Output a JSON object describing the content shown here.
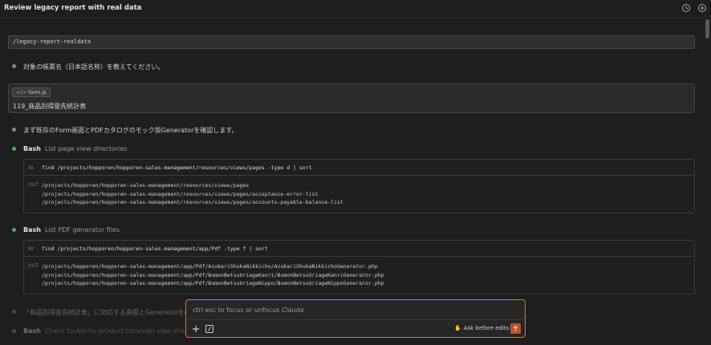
{
  "header": {
    "title": "Review legacy report with real data",
    "history_icon": "history-icon",
    "new_session_icon": "new-session-icon"
  },
  "command": "/legacy-report-realdata",
  "messages": [
    {
      "text": "対象の帳票名（日本語名称）を教えてください。"
    },
    {
      "text": "まず既存のForm画面とPDFカタログのモック版Generatorを確認します。"
    }
  ],
  "file_card": {
    "chip_icon": "code-icon",
    "chip_label": "form.js",
    "content": "119_商品別得意先統計表"
  },
  "tools": [
    {
      "name": "Bash",
      "description": "List page view directories",
      "in_label": "IN",
      "in": "find /projects/hopporen/hopporen-sales-management/resources/views/pages -type d | sort",
      "out_label": "OUT",
      "out": [
        "/projects/hopporen/hopporen-sales-management/resources/views/pages",
        "/projects/hopporen/hopporen-sales-management/resources/views/pages/acceptance-error-list",
        "/projects/hopporen/hopporen-sales-management/resources/views/pages/accounts-payable-balance-list"
      ]
    },
    {
      "name": "Bash",
      "description": "List PDF generator files",
      "in_label": "IN",
      "in": "find /projects/hopporen/hopporen-sales-management/app/Pdf -type f | sort",
      "out_label": "OUT",
      "out": [
        "/projects/hopporen/hopporen-sales-management/app/Pdf/AzukariShukaNikkicho/AzukariShukaNikkichoGenerator.php",
        "/projects/hopporen/hopporen-sales-management/app/Pdf/BumonBetsuUriageKanri/BumonBetsuUriageKanriGenerator.php",
        "/projects/hopporen/hopporen-sales-management/app/Pdf/BumonBetsuUriageNippo/BumonBetsuUriageNippoGenerator.php"
      ]
    }
  ],
  "faded": {
    "message": "「商品別得意先統計表」に対応する画面とGeneratorを確",
    "tool_name": "Bash",
    "tool_description": "Check toukei-by-product-tokuisaki view directory"
  },
  "composer": {
    "placeholder": "ctrl esc to focus or unfocus Claude",
    "add_icon": "plus-icon",
    "slash_icon": "slash-command-icon",
    "mode_icon": "hand-icon",
    "mode_label": "Ask before edits",
    "send_icon": "arrow-up-icon"
  },
  "colors": {
    "background": "#1e1e1e",
    "accent": "#d4714e",
    "send": "#b5552f",
    "status_green": "#4caf50"
  }
}
